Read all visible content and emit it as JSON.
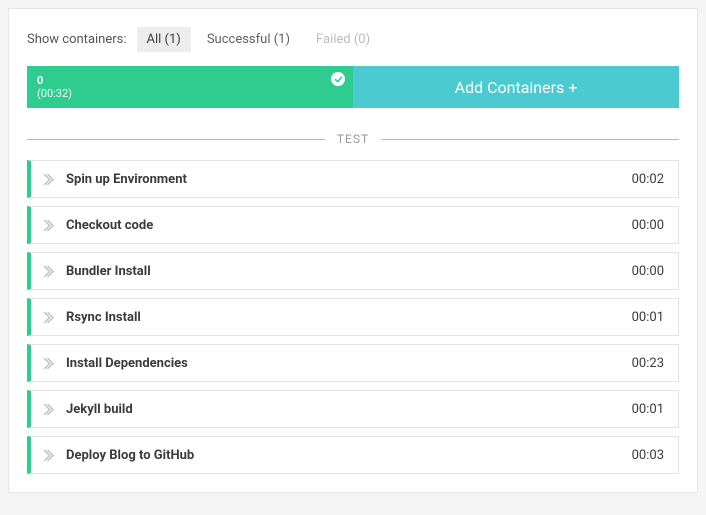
{
  "filter": {
    "label": "Show containers:",
    "all": "All (1)",
    "successful": "Successful (1)",
    "failed": "Failed (0)"
  },
  "container": {
    "index": "0",
    "time": "(00:32)"
  },
  "addButton": "Add Containers +",
  "sectionLabel": "TEST",
  "steps": [
    {
      "name": "Spin up Environment",
      "duration": "00:02"
    },
    {
      "name": "Checkout code",
      "duration": "00:00"
    },
    {
      "name": "Bundler Install",
      "duration": "00:00"
    },
    {
      "name": "Rsync Install",
      "duration": "00:01"
    },
    {
      "name": "Install Dependencies",
      "duration": "00:23"
    },
    {
      "name": "Jekyll build",
      "duration": "00:01"
    },
    {
      "name": "Deploy Blog to GitHub",
      "duration": "00:03"
    }
  ]
}
